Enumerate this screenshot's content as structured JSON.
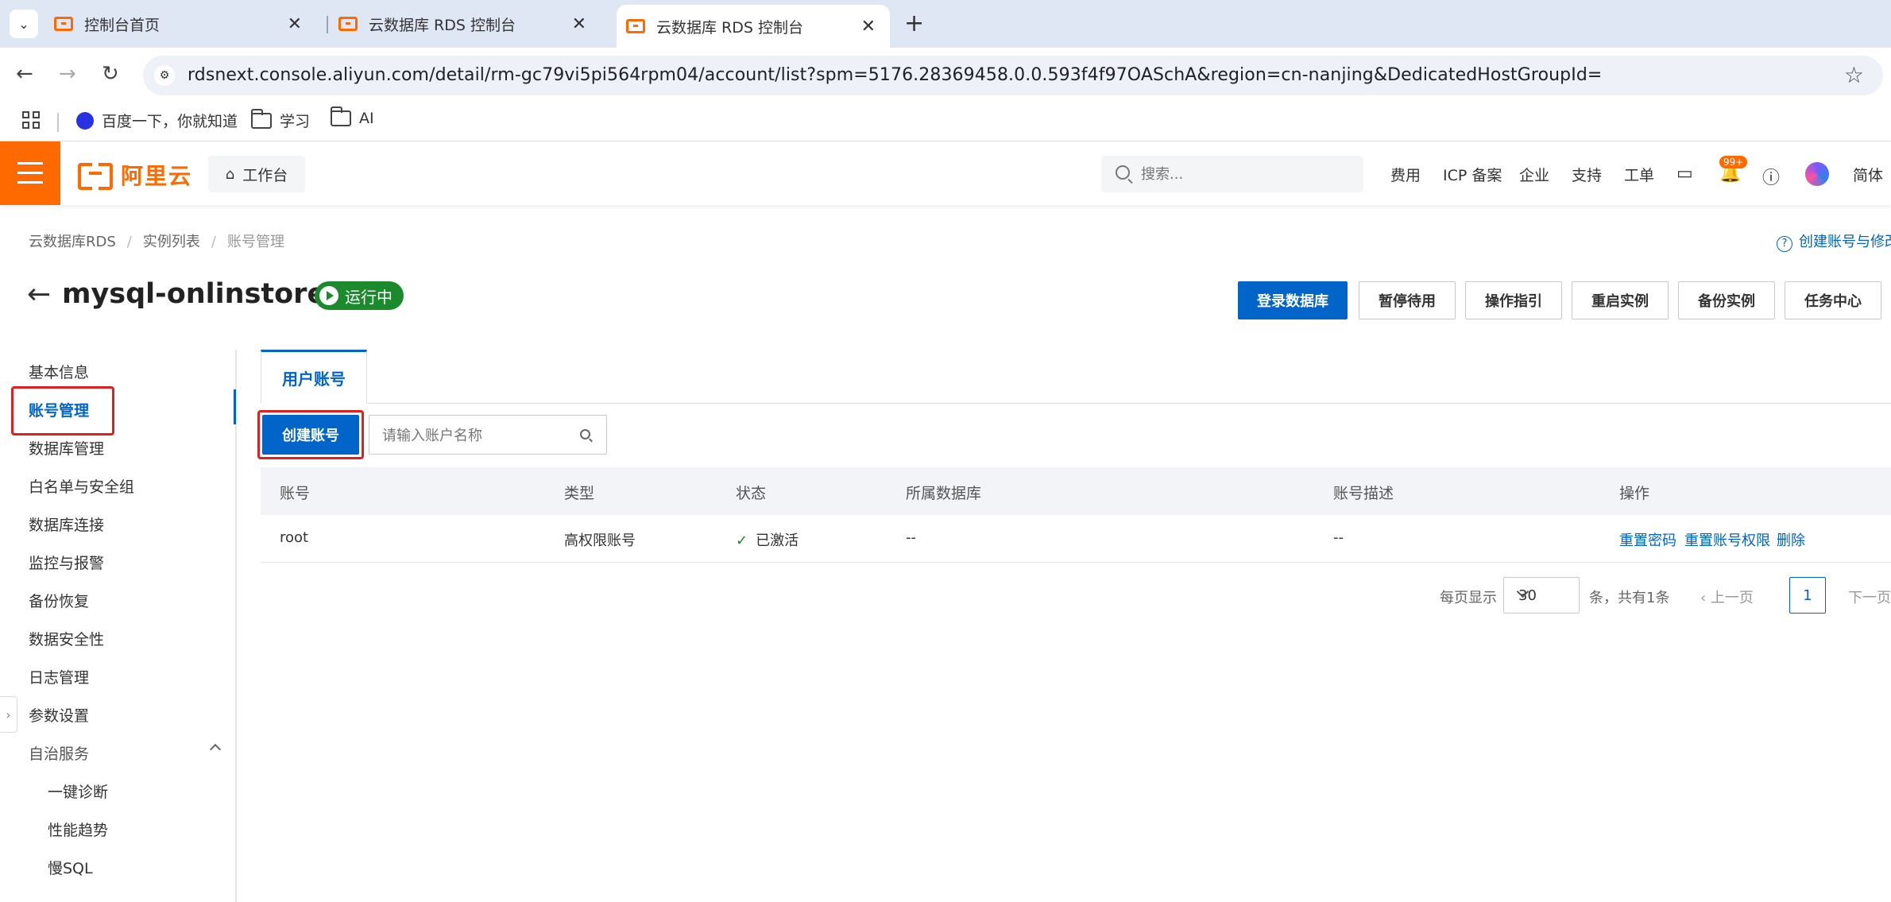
{
  "browser": {
    "tabs": [
      {
        "title": "控制台首页",
        "active": false
      },
      {
        "title": "云数据库 RDS 控制台",
        "active": false
      },
      {
        "title": "云数据库 RDS 控制台",
        "active": true
      }
    ],
    "url": "rdsnext.console.aliyun.com/detail/rm-gc79vi5pi564rpm04/account/list?spm=5176.28369458.0.0.593f4f97OASchA&region=cn-nanjing&DedicatedHostGroupId=",
    "bookmarks": [
      {
        "label": "百度一下，你就知道",
        "icon": "baidu-paw-icon"
      },
      {
        "label": "学习",
        "icon": "folder-icon"
      },
      {
        "label": "AI",
        "icon": "folder-icon"
      }
    ]
  },
  "topnav": {
    "logo_text": "阿里云",
    "workbench": "工作台",
    "search_placeholder": "搜索...",
    "links": [
      "费用",
      "ICP 备案",
      "企业",
      "支持",
      "工单"
    ],
    "notification_badge": "99+",
    "language": "简体",
    "brand_color": "#ff6a00"
  },
  "breadcrumb": [
    "云数据库RDS",
    "实例列表",
    "账号管理"
  ],
  "help_link": "创建账号与修改",
  "instance": {
    "name": "mysql-onlinstore01",
    "status": "运行中"
  },
  "actions": [
    "登录数据库",
    "暂停待用",
    "操作指引",
    "重启实例",
    "备份实例",
    "任务中心"
  ],
  "sidebar": {
    "items": [
      {
        "label": "基本信息"
      },
      {
        "label": "账号管理",
        "active": true
      },
      {
        "label": "数据库管理"
      },
      {
        "label": "白名单与安全组"
      },
      {
        "label": "数据库连接"
      },
      {
        "label": "监控与报警"
      },
      {
        "label": "备份恢复"
      },
      {
        "label": "数据安全性"
      },
      {
        "label": "日志管理"
      },
      {
        "label": "参数设置"
      }
    ],
    "group": "自治服务",
    "sub_items": [
      "一键诊断",
      "性能趋势",
      "慢SQL"
    ]
  },
  "main": {
    "tab": "用户账号",
    "create_button": "创建账号",
    "search_placeholder": "请输入账户名称",
    "columns": [
      "账号",
      "类型",
      "状态",
      "所属数据库",
      "账号描述",
      "操作"
    ],
    "rows": [
      {
        "account": "root",
        "type": "高权限账号",
        "status": "已激活",
        "database": "--",
        "description": "--",
        "operations": [
          "重置密码",
          "重置账号权限",
          "删除"
        ]
      }
    ],
    "pagination": {
      "per_page_label": "每页显示",
      "per_page": "30",
      "total_label": "条，共有1条",
      "prev": "上一页",
      "current": "1",
      "next": "下一页"
    }
  },
  "accent_color": "#0064c8"
}
